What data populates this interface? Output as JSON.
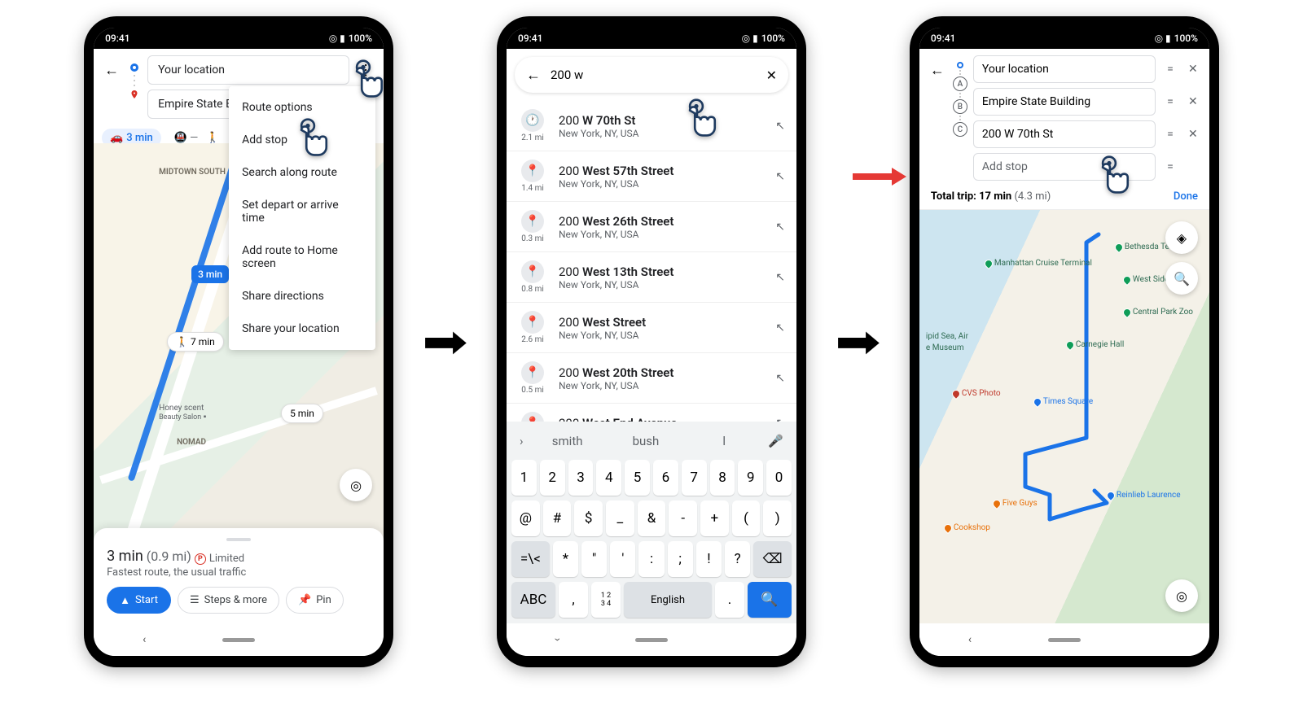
{
  "status": {
    "time": "09:41",
    "battery": "100%"
  },
  "screen1": {
    "from": "Your location",
    "to": "Empire State B",
    "mode_car": "3 min",
    "menu": [
      "Route options",
      "Add stop",
      "Search along route",
      "Set depart or arrive time",
      "Add route to Home screen",
      "Share directions",
      "Share your location"
    ],
    "map": {
      "midtown": "MIDTOWN\nSOUTH",
      "nomad": "NOMAD",
      "bubble_3": "3 min",
      "bubble_walk": "🚶 7 min",
      "bubble_5": "5 min",
      "honey": "Honey scent",
      "honey_sub": "Beauty Salon"
    },
    "card": {
      "time": "3 min",
      "dist": "(0.9 mi)",
      "park": "Limited",
      "sub": "Fastest route, the usual traffic",
      "start": "Start",
      "steps": "Steps & more",
      "pin": "Pin"
    }
  },
  "screen2": {
    "query": "200 w",
    "results": [
      {
        "icon": "clock",
        "dist": "2.1 mi",
        "title_pre": "200 ",
        "title_bold": "W 70th St",
        "sub": "New York, NY, USA"
      },
      {
        "icon": "pin",
        "dist": "1.4 mi",
        "title_pre": "200 ",
        "title_bold": "West 57th Street",
        "sub": "New York, NY, USA"
      },
      {
        "icon": "pin",
        "dist": "0.3 mi",
        "title_pre": "200 ",
        "title_bold": "West 26th Street",
        "sub": "New York, NY, USA"
      },
      {
        "icon": "pin",
        "dist": "0.8 mi",
        "title_pre": "200 ",
        "title_bold": "West 13th Street",
        "sub": "New York, NY, USA"
      },
      {
        "icon": "pin",
        "dist": "2.6 mi",
        "title_pre": "200 ",
        "title_bold": "West Street",
        "sub": "New York, NY, USA"
      },
      {
        "icon": "pin",
        "dist": "0.5 mi",
        "title_pre": "200 ",
        "title_bold": "West 20th Street",
        "sub": "New York, NY, USA"
      },
      {
        "icon": "pin",
        "dist": "",
        "title_pre": "200 ",
        "title_bold": "West End Avenue",
        "sub": ""
      }
    ],
    "suggestions": [
      "smith",
      "bush",
      "l"
    ],
    "kb_row1": [
      "1",
      "2",
      "3",
      "4",
      "5",
      "6",
      "7",
      "8",
      "9",
      "0"
    ],
    "kb_row2": [
      "@",
      "#",
      "$",
      "_",
      "&",
      "-",
      "+",
      "(",
      ")"
    ],
    "kb_row3": [
      "=\\<",
      "*",
      "\"",
      "'",
      ":",
      ";",
      "!",
      "?",
      "⌫"
    ],
    "kb_row4_abc": "ABC",
    "kb_row4_comma": ",",
    "kb_row4_nums": "1 2\n3 4",
    "kb_row4_lang": "English"
  },
  "screen3": {
    "stops": [
      {
        "marker": "origin",
        "label": "Your location"
      },
      {
        "marker": "A",
        "label": "Empire State Building"
      },
      {
        "marker": "B",
        "label": "200 W 70th St"
      },
      {
        "marker": "C",
        "label": "Add stop"
      }
    ],
    "trip_label": "Total trip:",
    "trip_time": "17 min",
    "trip_dist": "(4.3 mi)",
    "done": "Done",
    "pois": [
      "Manhattan Cruise Terminal",
      "Bethesda Terrace",
      "West Side YMCA",
      "Central Park Zoo",
      "Carnegie Hall",
      "Times Square",
      "CVS Photo",
      "Five Guys",
      "Cookshop",
      "Reinlieb Laurence",
      "ipid Sea, Air",
      "e Museum"
    ]
  }
}
